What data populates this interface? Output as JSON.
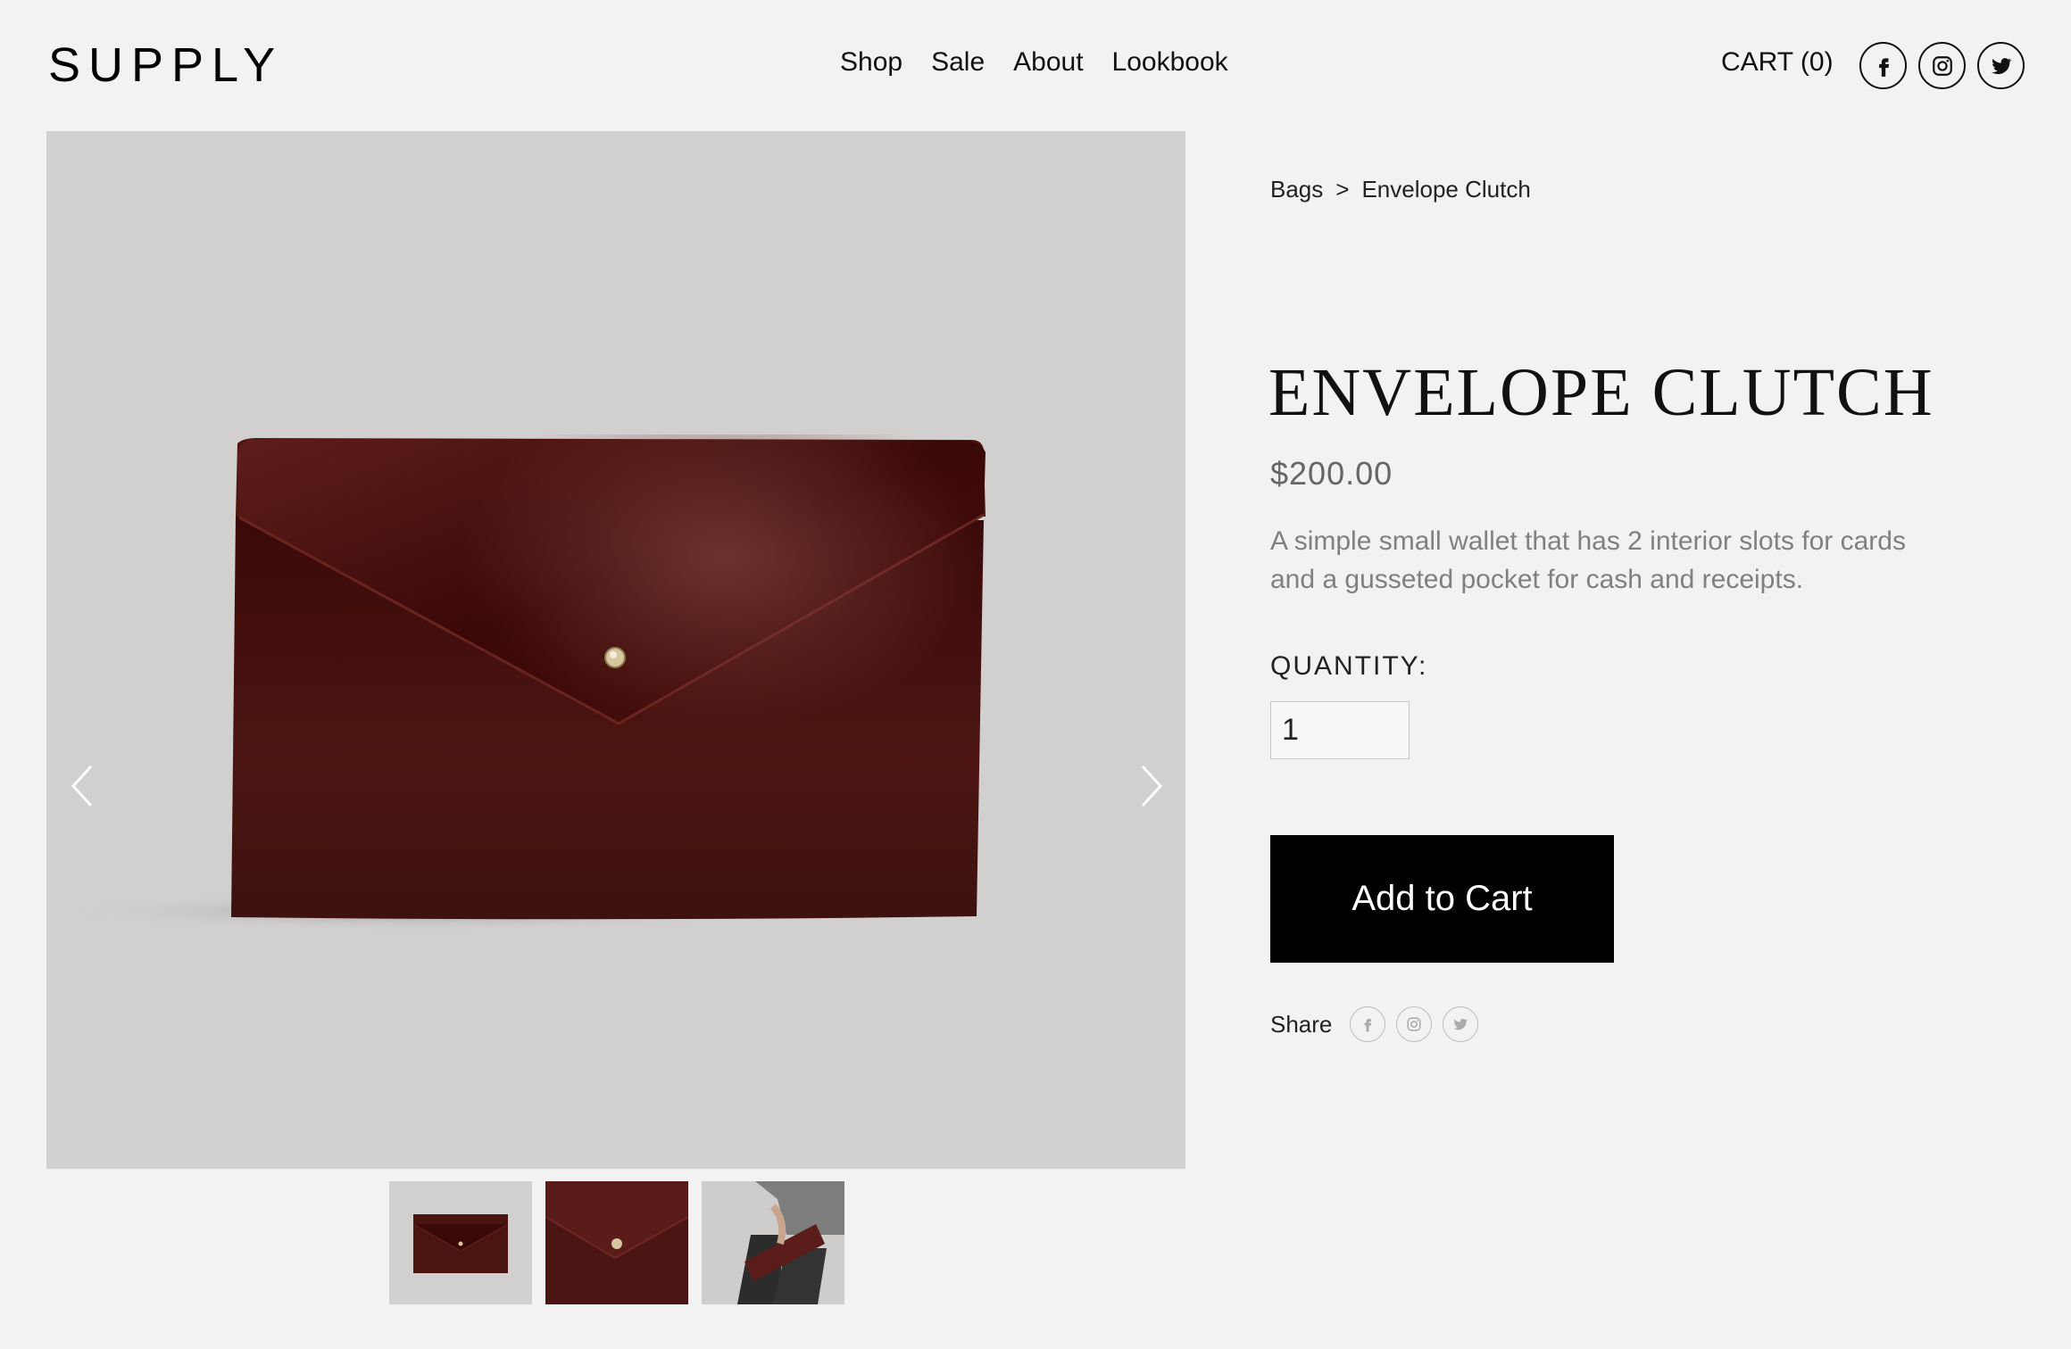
{
  "brand": {
    "logo_text": "SUPPLY"
  },
  "nav": {
    "items": [
      {
        "label": "Shop"
      },
      {
        "label": "Sale"
      },
      {
        "label": "About"
      },
      {
        "label": "Lookbook"
      }
    ],
    "cart_label": "CART (0)"
  },
  "social_icons": [
    "facebook-icon",
    "instagram-icon",
    "twitter-icon"
  ],
  "gallery": {
    "thumbnails": [
      "clutch-front",
      "clutch-closeup",
      "clutch-in-hand"
    ],
    "prev_icon": "chevron-left-icon",
    "next_icon": "chevron-right-icon"
  },
  "breadcrumb": {
    "parent": "Bags",
    "separator": ">",
    "current": "Envelope Clutch"
  },
  "product": {
    "title": "ENVELOPE CLUTCH",
    "price": "$200.00",
    "description": "A simple small wallet that has 2 interior slots for cards and a gusseted pocket for cash and receipts.",
    "quantity_label": "QUANTITY:",
    "quantity_value": "1",
    "add_to_cart_label": "Add to Cart"
  },
  "share": {
    "label": "Share"
  },
  "colors": {
    "background": "#f2f2f2",
    "hero_background": "#d2cfcf",
    "leather": "#4a1512",
    "button": "#000000",
    "muted_text": "#808080"
  }
}
